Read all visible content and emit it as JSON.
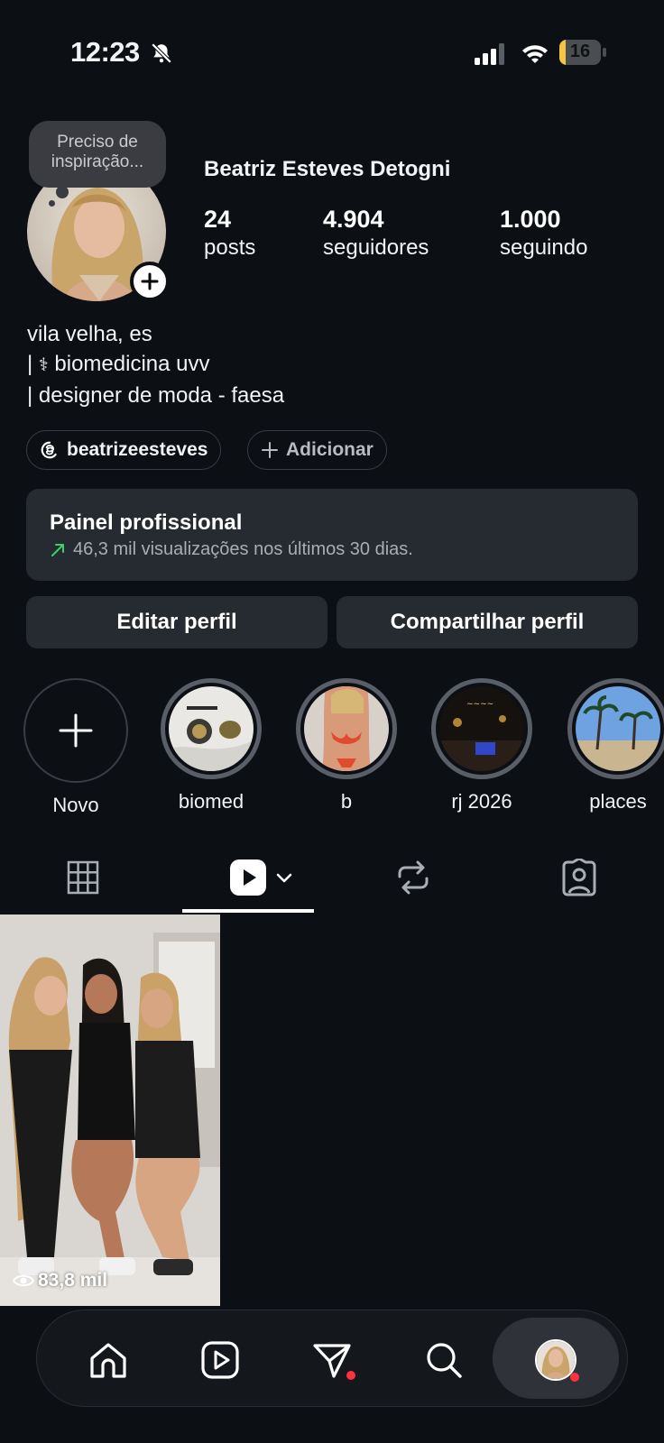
{
  "status_bar": {
    "time": "12:23",
    "battery": "16",
    "battery_level": 0.16
  },
  "profile": {
    "note": "Preciso de inspiração...",
    "name": "Beatriz Esteves Detogni",
    "stats": [
      {
        "value": "24",
        "label": "posts"
      },
      {
        "value": "4.904",
        "label": "seguidores"
      },
      {
        "value": "1.000",
        "label": "seguindo"
      }
    ],
    "bio": {
      "line1": "vila velha, es",
      "line2_prefix": "| ",
      "line2_symbol": "⚕",
      "line2_text": " biomedicina uvv",
      "line3": "| designer de moda - faesa"
    },
    "threads_handle": "beatrizeesteves",
    "add_link_label": "Adicionar"
  },
  "dashboard": {
    "title": "Painel profissional",
    "subtitle": "46,3 mil visualizações nos últimos 30 dias."
  },
  "buttons": {
    "edit": "Editar perfil",
    "share": "Compartilhar perfil"
  },
  "highlights": [
    {
      "label": "Novo"
    },
    {
      "label": "biomed"
    },
    {
      "label": "b"
    },
    {
      "label": "rj 2026"
    },
    {
      "label": "places"
    }
  ],
  "tabs": [
    "grid-icon",
    "reels-icon",
    "reposts-icon",
    "tagged-icon"
  ],
  "posts": [
    {
      "views": "83,8 mil"
    }
  ],
  "colors": {
    "background": "#0c0f14",
    "card": "#262a31",
    "notification": "#ff3040",
    "trend_up": "#3ccf6a"
  }
}
